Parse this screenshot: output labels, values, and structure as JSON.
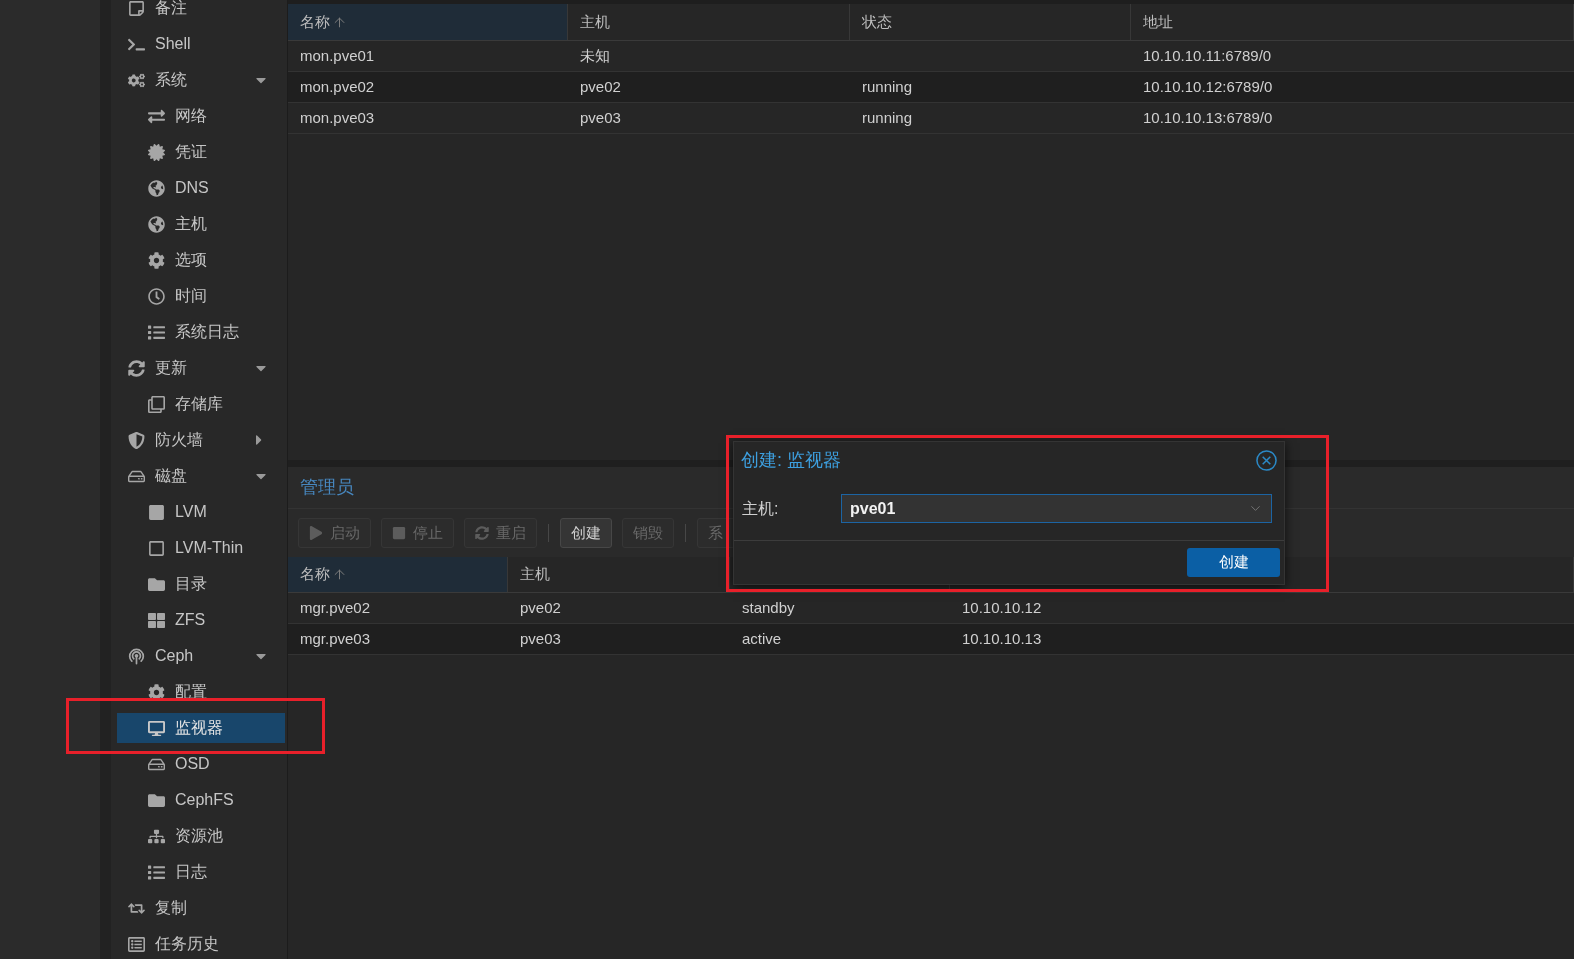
{
  "sidebar": {
    "items": [
      {
        "label": "备注",
        "selected": false,
        "highlighted": false
      },
      {
        "label": "Shell",
        "selected": false,
        "highlighted": false
      },
      {
        "label": "系统",
        "selected": false,
        "highlighted": false,
        "expanded": true,
        "children": [
          {
            "label": "网络",
            "selected": false,
            "highlighted": false
          },
          {
            "label": "凭证",
            "selected": false,
            "highlighted": false
          },
          {
            "label": "DNS",
            "selected": false,
            "highlighted": false
          },
          {
            "label": "主机",
            "selected": false,
            "highlighted": false
          },
          {
            "label": "选项",
            "selected": false,
            "highlighted": false
          },
          {
            "label": "时间",
            "selected": false,
            "highlighted": false
          },
          {
            "label": "系统日志",
            "selected": false,
            "highlighted": false
          }
        ]
      },
      {
        "label": "更新",
        "selected": false,
        "highlighted": false,
        "expanded": true,
        "children": [
          {
            "label": "存储库",
            "selected": false,
            "highlighted": false
          }
        ]
      },
      {
        "label": "防火墙",
        "selected": false,
        "highlighted": false,
        "expanded": false
      },
      {
        "label": "磁盘",
        "selected": false,
        "highlighted": false,
        "expanded": true,
        "children": [
          {
            "label": "LVM",
            "selected": false,
            "highlighted": false
          },
          {
            "label": "LVM-Thin",
            "selected": false,
            "highlighted": false
          },
          {
            "label": "目录",
            "selected": false,
            "highlighted": false
          },
          {
            "label": "ZFS",
            "selected": false,
            "highlighted": false
          }
        ]
      },
      {
        "label": "Ceph",
        "selected": false,
        "highlighted": false,
        "expanded": true,
        "children": [
          {
            "label": "配置",
            "selected": false,
            "highlighted": false
          },
          {
            "label": "监视器",
            "selected": true,
            "highlighted": true
          },
          {
            "label": "OSD",
            "selected": false,
            "highlighted": false
          },
          {
            "label": "CephFS",
            "selected": false,
            "highlighted": false
          },
          {
            "label": "资源池",
            "selected": false,
            "highlighted": false
          },
          {
            "label": "日志",
            "selected": false,
            "highlighted": false
          }
        ]
      },
      {
        "label": "复制",
        "selected": false,
        "highlighted": false
      },
      {
        "label": "任务历史",
        "selected": false,
        "highlighted": false
      }
    ]
  },
  "monitors": {
    "columns": [
      {
        "label": "名称",
        "sorted": true
      },
      {
        "label": "主机",
        "sorted": false
      },
      {
        "label": "状态",
        "sorted": false
      },
      {
        "label": "地址",
        "sorted": false
      }
    ],
    "rows": [
      {
        "name": "mon.pve01",
        "host": "未知",
        "address": "10.10.10.11:6789/0"
      },
      {
        "name": "mon.pve02",
        "host": "pve02",
        "status": "running",
        "address": "10.10.10.12:6789/0"
      },
      {
        "name": "mon.pve03",
        "host": "pve03",
        "status": "running",
        "address": "10.10.10.13:6789/0"
      }
    ]
  },
  "managers": {
    "title": "管理员",
    "toolbar": [
      {
        "kind": "button",
        "label": "启动",
        "disabled": true
      },
      {
        "kind": "button",
        "label": "停止",
        "disabled": true
      },
      {
        "kind": "button",
        "label": "重启",
        "disabled": true
      },
      {
        "kind": "separator"
      },
      {
        "kind": "button",
        "label": "创建",
        "disabled": false
      },
      {
        "kind": "button",
        "label": "销毁",
        "disabled": true
      },
      {
        "kind": "separator"
      },
      {
        "kind": "button",
        "label": "系",
        "disabled": true
      }
    ],
    "columns": [
      {
        "label": "名称",
        "sorted": true
      },
      {
        "label": "主机",
        "sorted": false
      }
    ],
    "rows": [
      {
        "name": "mgr.pve02",
        "host": "pve02",
        "column_3": "standby",
        "column_4": "10.10.10.12"
      },
      {
        "name": "mgr.pve03",
        "host": "pve03",
        "column_3": "active",
        "column_4": "10.10.10.13"
      }
    ]
  },
  "dialog": {
    "title": "创建: 监视器",
    "highlighted": true,
    "fields": [
      {
        "label": "主机:",
        "value": "pve01",
        "focused": true
      }
    ],
    "buttons": [
      "创建"
    ]
  }
}
